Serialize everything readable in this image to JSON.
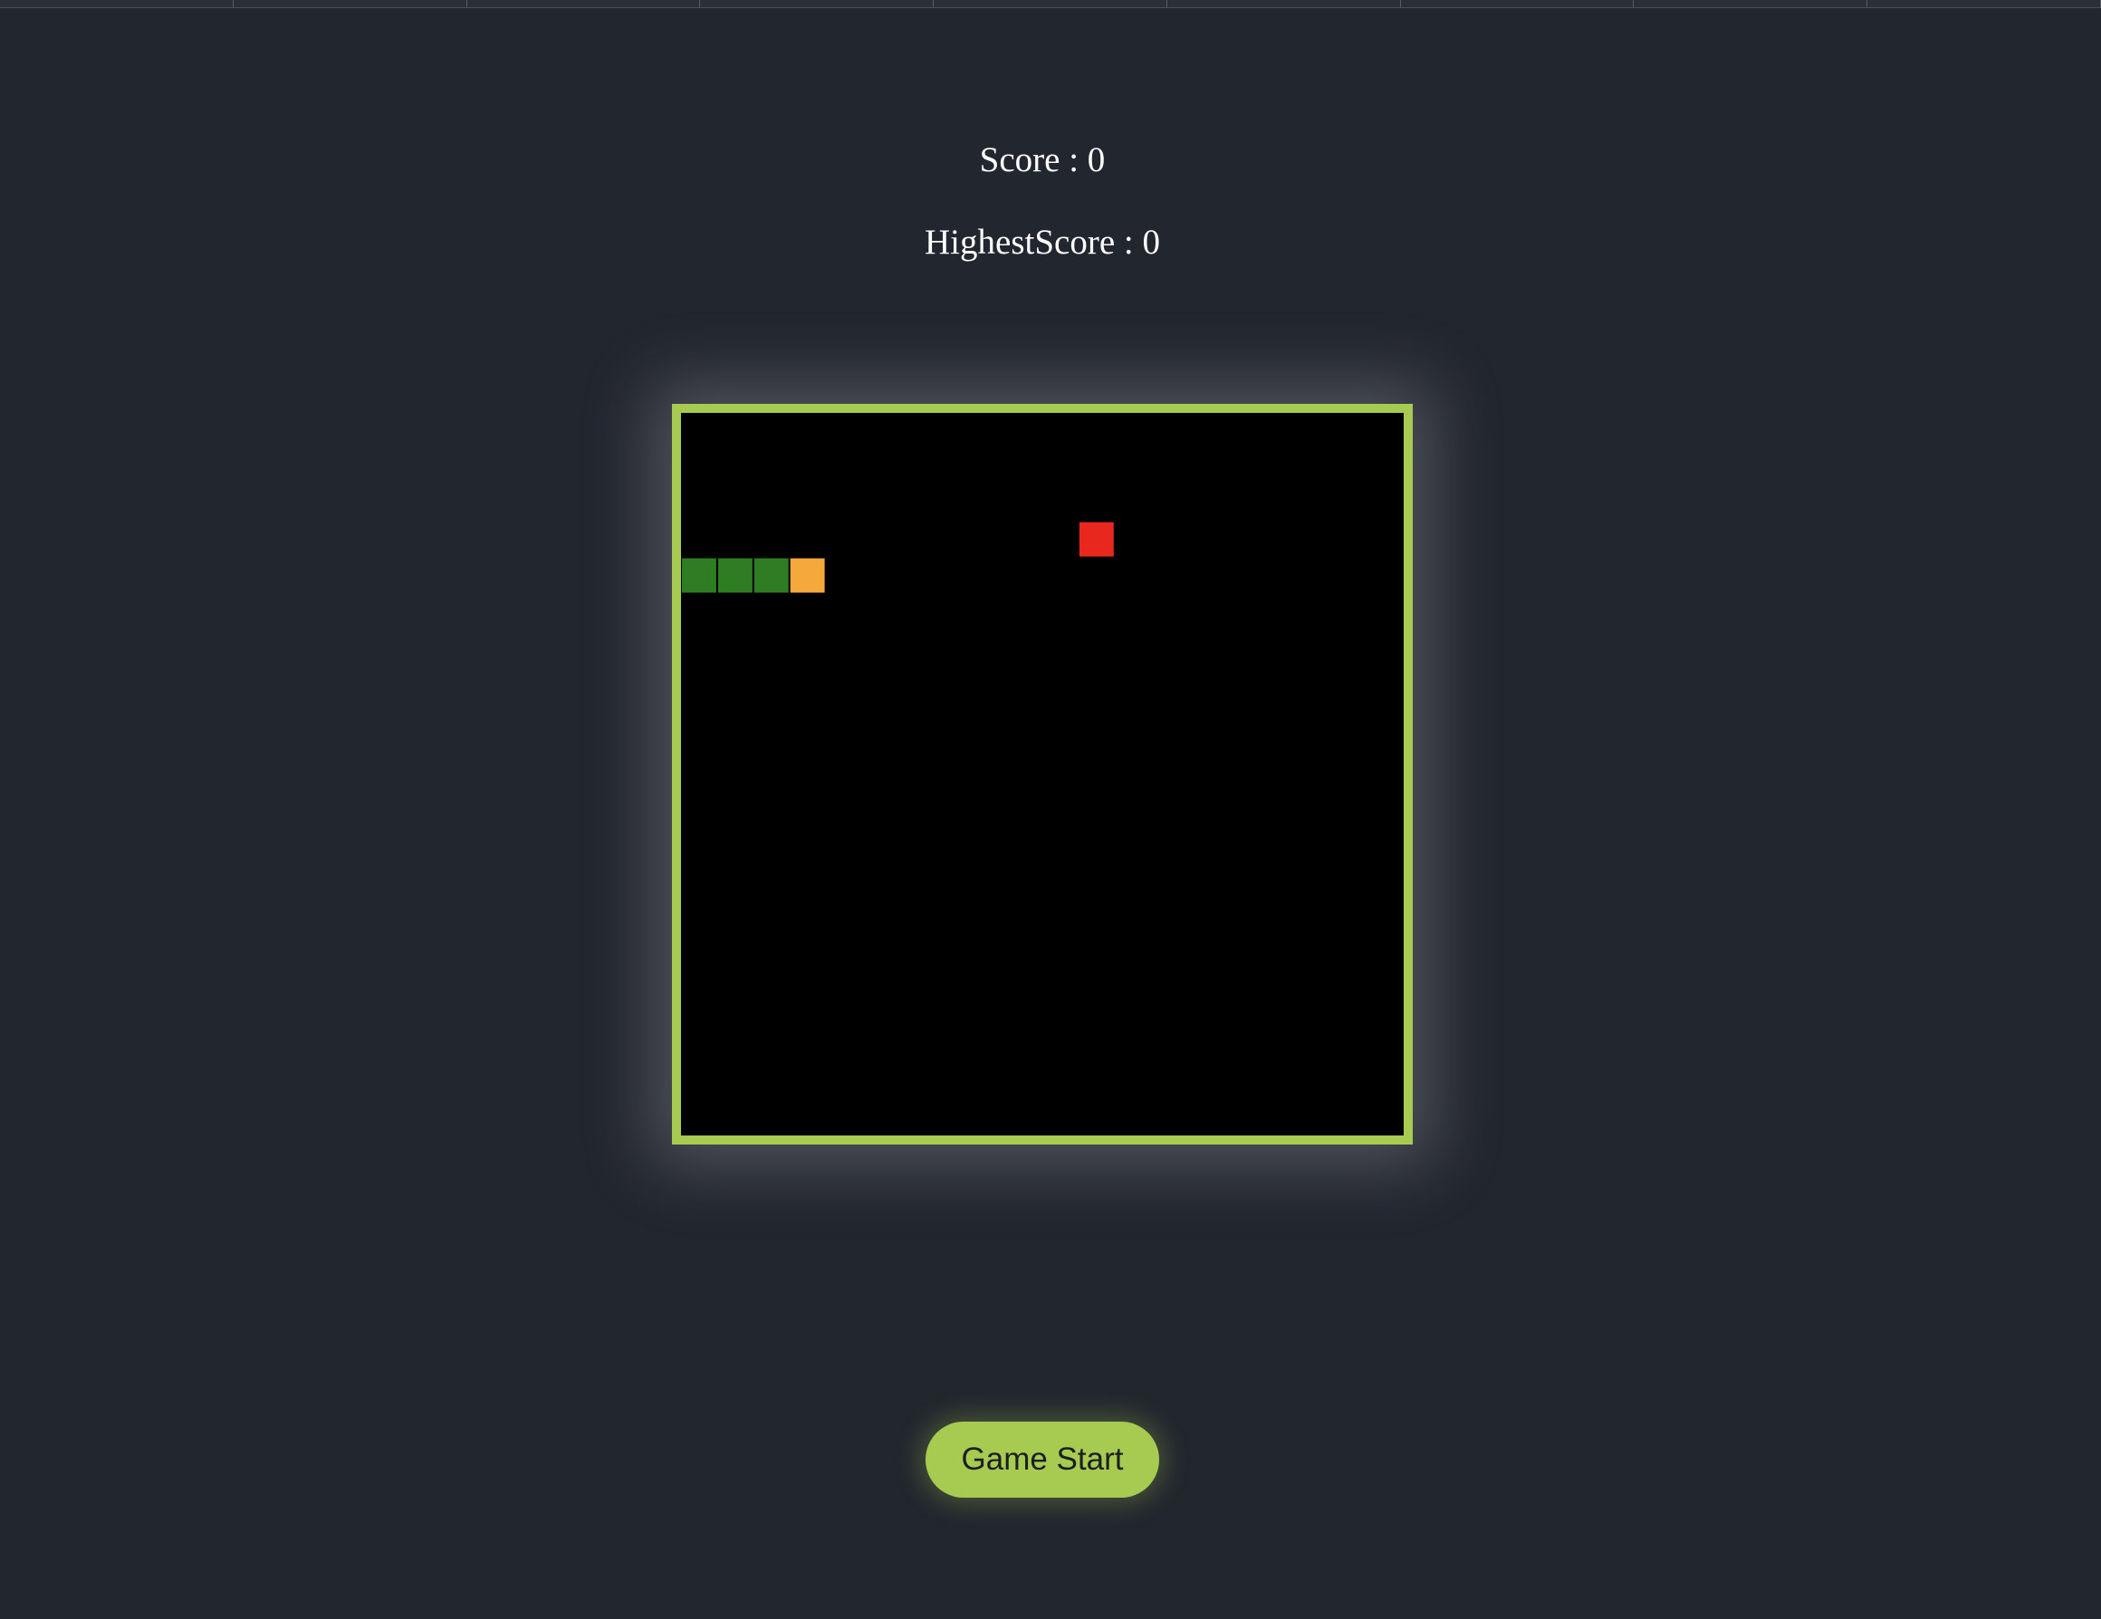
{
  "scoreboard": {
    "score_text": "Score : 0",
    "highest_text": "HighestScore : 0"
  },
  "board": {
    "cols": 20,
    "rows": 20,
    "border_color": "#a7ca50",
    "background": "#000000",
    "snake": {
      "body_color": "#2e7d22",
      "head_color": "#f4a93a",
      "segments": [
        [
          0,
          4
        ],
        [
          1,
          4
        ],
        [
          2,
          4
        ],
        [
          3,
          4
        ]
      ]
    },
    "food": {
      "color": "#e8281e",
      "cell": [
        11,
        3
      ]
    }
  },
  "controls": {
    "start_label": "Game Start",
    "accent": "#a7ca50"
  }
}
